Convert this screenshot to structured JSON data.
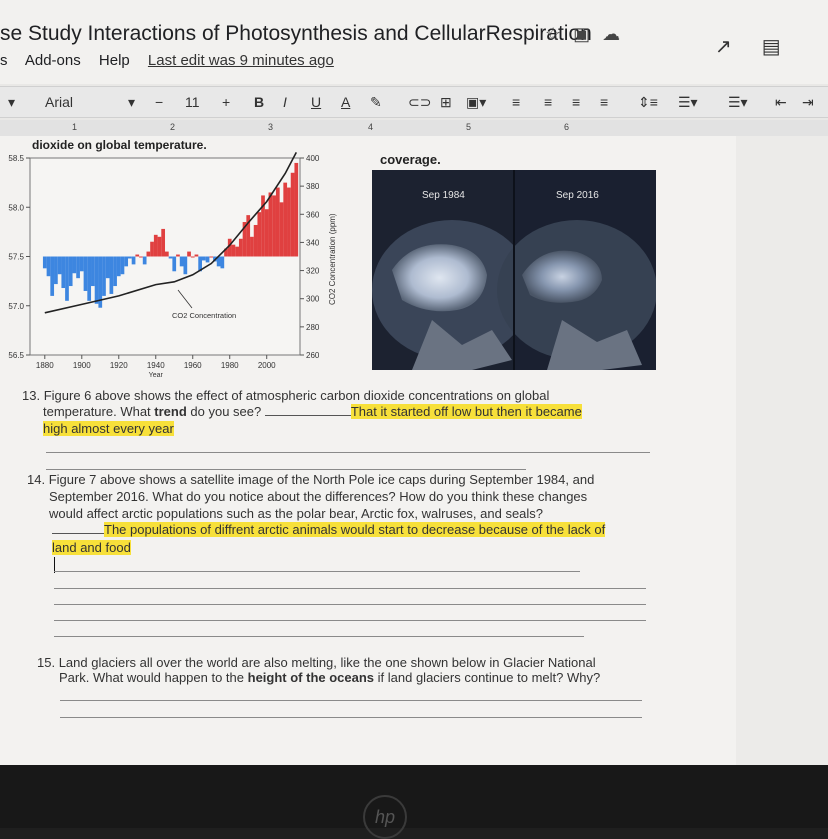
{
  "doc": {
    "title": "se Study Interactions of Photosynthesis and CellularRespiration",
    "menu": [
      "s",
      "Add-ons",
      "Help"
    ],
    "last_edit": "Last edit was 9 minutes ago"
  },
  "toolbar": {
    "font": "Arial",
    "font_size": "11",
    "minus": "−",
    "plus": "+",
    "bold": "B",
    "italic": "I",
    "underline": "U",
    "text_color": "A"
  },
  "ruler": [
    "1",
    "2",
    "3",
    "4",
    "5",
    "6"
  ],
  "figure6": {
    "caption": "dioxide on global temperature.",
    "co2_label": "CO2 Concentration",
    "right_axis_label": "CO2 Concentration (ppm)",
    "xlabel": "Year"
  },
  "chart_data": {
    "type": "bar",
    "x_ticks": [
      "1880",
      "1900",
      "1920",
      "1940",
      "1960",
      "1980",
      "2000"
    ],
    "left_ticks": [
      "58.5",
      "58.0",
      "57.5",
      "57.0",
      "56.5"
    ],
    "right_ticks": [
      "400",
      "380",
      "360",
      "340",
      "320",
      "300",
      "280",
      "260"
    ],
    "xlabel": "Year",
    "ylabel_right": "CO2 Concentration (ppm)",
    "annotation": "CO2 Concentration",
    "baseline": 57.5,
    "ylim": [
      56.5,
      58.5
    ],
    "bars": [
      {
        "x": 1880,
        "y": 57.38
      },
      {
        "x": 1882,
        "y": 57.3
      },
      {
        "x": 1884,
        "y": 57.1
      },
      {
        "x": 1886,
        "y": 57.22
      },
      {
        "x": 1888,
        "y": 57.32
      },
      {
        "x": 1890,
        "y": 57.18
      },
      {
        "x": 1892,
        "y": 57.05
      },
      {
        "x": 1894,
        "y": 57.2
      },
      {
        "x": 1896,
        "y": 57.33
      },
      {
        "x": 1898,
        "y": 57.28
      },
      {
        "x": 1900,
        "y": 57.35
      },
      {
        "x": 1902,
        "y": 57.15
      },
      {
        "x": 1904,
        "y": 57.05
      },
      {
        "x": 1906,
        "y": 57.2
      },
      {
        "x": 1908,
        "y": 57.02
      },
      {
        "x": 1910,
        "y": 56.98
      },
      {
        "x": 1912,
        "y": 57.1
      },
      {
        "x": 1914,
        "y": 57.28
      },
      {
        "x": 1916,
        "y": 57.12
      },
      {
        "x": 1918,
        "y": 57.2
      },
      {
        "x": 1920,
        "y": 57.3
      },
      {
        "x": 1922,
        "y": 57.32
      },
      {
        "x": 1924,
        "y": 57.4
      },
      {
        "x": 1926,
        "y": 57.48
      },
      {
        "x": 1928,
        "y": 57.42
      },
      {
        "x": 1930,
        "y": 57.52
      },
      {
        "x": 1932,
        "y": 57.5
      },
      {
        "x": 1934,
        "y": 57.42
      },
      {
        "x": 1936,
        "y": 57.55
      },
      {
        "x": 1938,
        "y": 57.65
      },
      {
        "x": 1940,
        "y": 57.72
      },
      {
        "x": 1942,
        "y": 57.7
      },
      {
        "x": 1944,
        "y": 57.78
      },
      {
        "x": 1946,
        "y": 57.55
      },
      {
        "x": 1948,
        "y": 57.48
      },
      {
        "x": 1950,
        "y": 57.35
      },
      {
        "x": 1952,
        "y": 57.52
      },
      {
        "x": 1954,
        "y": 57.4
      },
      {
        "x": 1956,
        "y": 57.32
      },
      {
        "x": 1958,
        "y": 57.55
      },
      {
        "x": 1960,
        "y": 57.5
      },
      {
        "x": 1962,
        "y": 57.52
      },
      {
        "x": 1964,
        "y": 57.35
      },
      {
        "x": 1966,
        "y": 57.46
      },
      {
        "x": 1968,
        "y": 57.44
      },
      {
        "x": 1970,
        "y": 57.5
      },
      {
        "x": 1972,
        "y": 57.45
      },
      {
        "x": 1974,
        "y": 57.4
      },
      {
        "x": 1976,
        "y": 57.38
      },
      {
        "x": 1978,
        "y": 57.58
      },
      {
        "x": 1980,
        "y": 57.68
      },
      {
        "x": 1982,
        "y": 57.62
      },
      {
        "x": 1984,
        "y": 57.6
      },
      {
        "x": 1986,
        "y": 57.68
      },
      {
        "x": 1988,
        "y": 57.85
      },
      {
        "x": 1990,
        "y": 57.92
      },
      {
        "x": 1992,
        "y": 57.7
      },
      {
        "x": 1994,
        "y": 57.82
      },
      {
        "x": 1996,
        "y": 57.95
      },
      {
        "x": 1998,
        "y": 58.12
      },
      {
        "x": 2000,
        "y": 57.98
      },
      {
        "x": 2002,
        "y": 58.15
      },
      {
        "x": 2004,
        "y": 58.12
      },
      {
        "x": 2006,
        "y": 58.2
      },
      {
        "x": 2008,
        "y": 58.05
      },
      {
        "x": 2010,
        "y": 58.25
      },
      {
        "x": 2012,
        "y": 58.2
      },
      {
        "x": 2014,
        "y": 58.35
      },
      {
        "x": 2016,
        "y": 58.45
      }
    ],
    "co2_line": {
      "x": [
        1880,
        1900,
        1920,
        1940,
        1950,
        1960,
        1970,
        1980,
        1990,
        2000,
        2010,
        2016
      ],
      "y": [
        290,
        296,
        302,
        310,
        312,
        317,
        325,
        338,
        354,
        369,
        389,
        404
      ]
    },
    "co2_ylim": [
      260,
      400
    ],
    "colors": {
      "above": "#e04040",
      "below": "#3d86e0"
    }
  },
  "figure7": {
    "caption": "coverage.",
    "date_left": "Sep 1984",
    "date_right": "Sep 2016"
  },
  "q13": {
    "num": "13.",
    "text1": "Figure 6 above shows the effect of atmospheric carbon dioxide concentrations on global",
    "text2a": "temperature. What ",
    "text2b": "trend",
    "text2c": " do you see? ",
    "answer1": "That it started off low but then it became",
    "answer2": "high almost every year"
  },
  "q14": {
    "num": "14.",
    "text1": "Figure 7 above shows a satellite image of the North Pole ice caps during September 1984, and",
    "text2": "September 2016. What do you notice about the differences? How do you think these changes",
    "text3": "would affect arctic populations such as the polar bear, Arctic fox, walruses, and seals?",
    "answer1": "The populations of diffrent arctic animals would start to decrease because of the lack of",
    "answer2": "land and food"
  },
  "q15": {
    "num": "15.",
    "text1": "Land glaciers all over the world are also melting, like the one shown below in Glacier National",
    "text2a": "Park. What would happen to the ",
    "text2b": "height of the oceans",
    "text2c": " if land glaciers continue to melt? Why?"
  },
  "monitor": {
    "logo": "hp"
  }
}
